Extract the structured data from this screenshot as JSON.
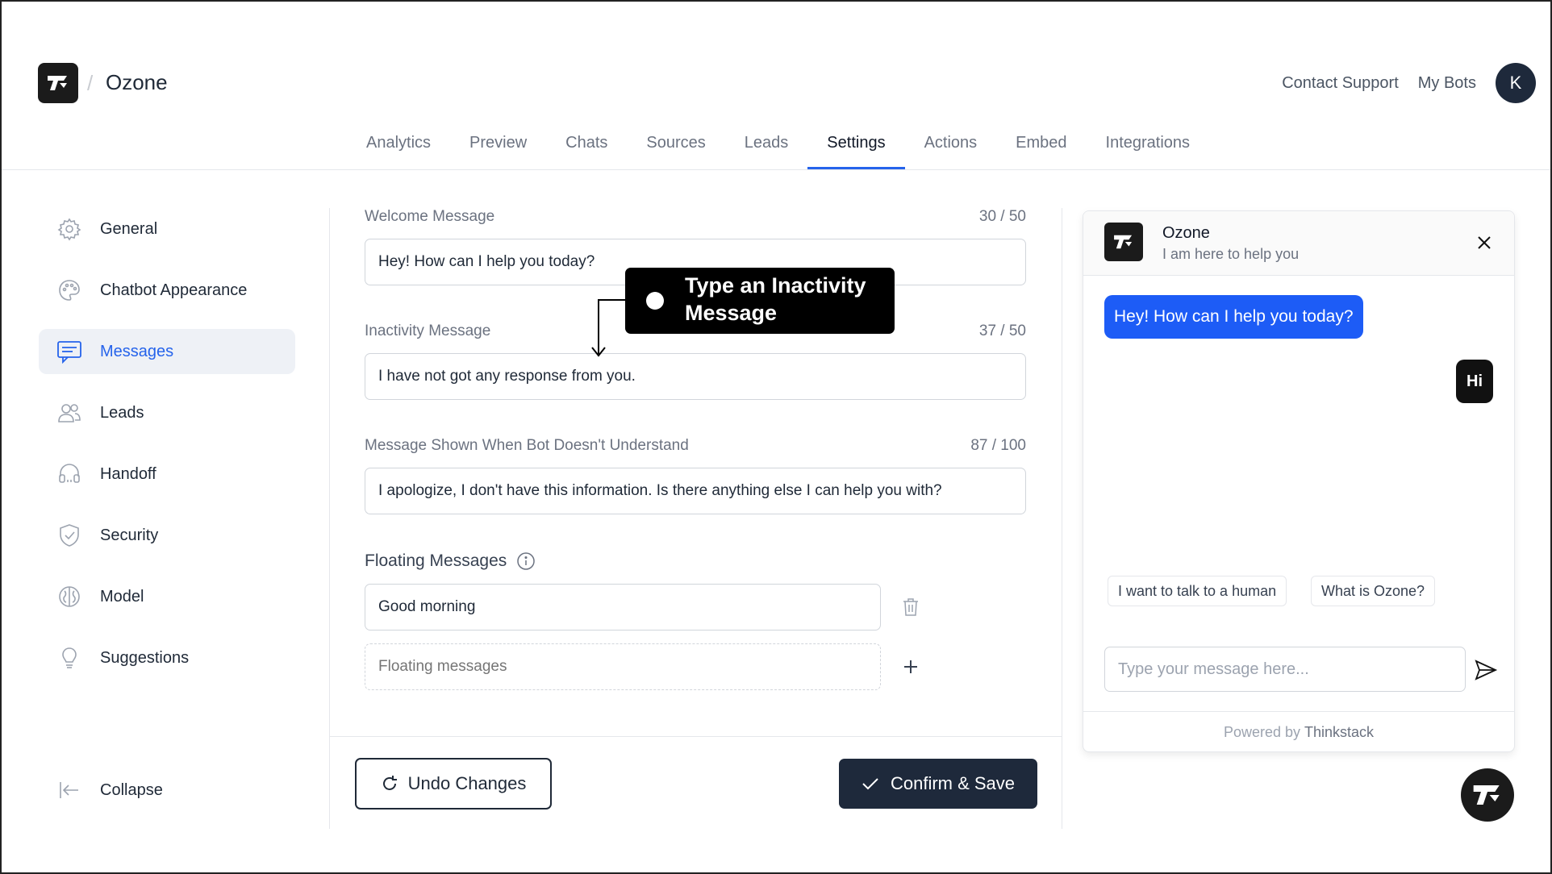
{
  "header": {
    "brand": "Ozone",
    "separator": "/",
    "contact_support": "Contact Support",
    "my_bots": "My Bots",
    "avatar_initial": "K"
  },
  "tabs": [
    {
      "label": "Analytics",
      "active": false
    },
    {
      "label": "Preview",
      "active": false
    },
    {
      "label": "Chats",
      "active": false
    },
    {
      "label": "Sources",
      "active": false
    },
    {
      "label": "Leads",
      "active": false
    },
    {
      "label": "Settings",
      "active": true
    },
    {
      "label": "Actions",
      "active": false
    },
    {
      "label": "Embed",
      "active": false
    },
    {
      "label": "Integrations",
      "active": false
    }
  ],
  "sidebar": {
    "items": [
      {
        "label": "General",
        "icon": "gear-icon",
        "active": false
      },
      {
        "label": "Chatbot Appearance",
        "icon": "palette-icon",
        "active": false
      },
      {
        "label": "Messages",
        "icon": "message-icon",
        "active": true
      },
      {
        "label": "Leads",
        "icon": "users-icon",
        "active": false
      },
      {
        "label": "Handoff",
        "icon": "headset-icon",
        "active": false
      },
      {
        "label": "Security",
        "icon": "shield-icon",
        "active": false
      },
      {
        "label": "Model",
        "icon": "brain-icon",
        "active": false
      },
      {
        "label": "Suggestions",
        "icon": "lightbulb-icon",
        "active": false
      }
    ],
    "collapse_label": "Collapse"
  },
  "form": {
    "welcome": {
      "label": "Welcome Message",
      "count": "30 / 50",
      "value": "Hey! How can I help you today?"
    },
    "inactivity": {
      "label": "Inactivity Message",
      "count": "37 / 50",
      "value": "I have not got any response from you."
    },
    "not_understand": {
      "label": "Message Shown When Bot Doesn't Understand",
      "count": "87 / 100",
      "value": "I apologize, I don't have this information. Is there anything else I can help you with?"
    },
    "floating": {
      "label": "Floating Messages",
      "values": [
        "Good morning"
      ],
      "placeholder": "Floating messages"
    },
    "undo_label": "Undo Changes",
    "save_label": "Confirm & Save"
  },
  "tooltip": {
    "text_line1": "Type an Inactivity",
    "text_line2": "Message"
  },
  "chat": {
    "title": "Ozone",
    "subtitle": "I am here to help you",
    "bot_message": "Hey! How can I help you today?",
    "user_message": "Hi",
    "suggestions": [
      "I want to talk to a human",
      "What is Ozone?"
    ],
    "input_placeholder": "Type your message here...",
    "powered_by": "Powered by",
    "powered_brand": "Thinkstack"
  },
  "colors": {
    "accent": "#2563eb",
    "bot_bubble": "#1d5cf6",
    "dark": "#1e293b"
  }
}
